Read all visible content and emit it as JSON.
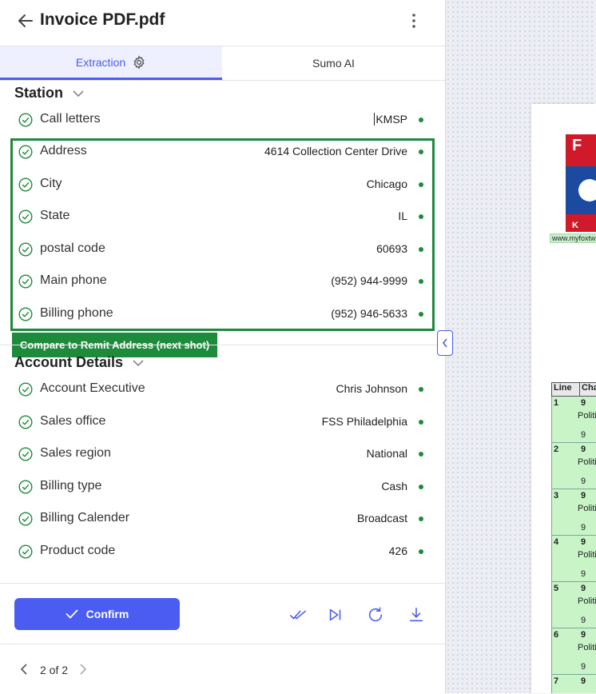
{
  "header": {
    "title": "Invoice PDF.pdf"
  },
  "tabs": [
    {
      "label": "Extraction",
      "active": true
    },
    {
      "label": "Sumo AI",
      "active": false
    }
  ],
  "station": {
    "title": "Station",
    "fields": [
      {
        "label": "Call letters",
        "value": "KMSP"
      },
      {
        "label": "Address",
        "value": "4614 Collection Center Drive"
      },
      {
        "label": "City",
        "value": "Chicago"
      },
      {
        "label": "State",
        "value": "IL"
      },
      {
        "label": "postal code",
        "value": "60693"
      },
      {
        "label": "Main phone",
        "value": "(952) 944-9999"
      },
      {
        "label": "Billing phone",
        "value": "(952) 946-5633"
      }
    ]
  },
  "annotation": {
    "label": "Compare to Remit Address (next shot)"
  },
  "account": {
    "title": "Account Details",
    "fields": [
      {
        "label": "Account Executive",
        "value": "Chris Johnson"
      },
      {
        "label": "Sales office",
        "value": "FSS Philadelphia"
      },
      {
        "label": "Sales region",
        "value": "National"
      },
      {
        "label": "Billing type",
        "value": "Cash"
      },
      {
        "label": "Billing Calender",
        "value": "Broadcast"
      },
      {
        "label": "Product code",
        "value": "426"
      }
    ]
  },
  "footer": {
    "confirm_label": "Confirm"
  },
  "pager": {
    "label": "2 of 2"
  },
  "document": {
    "logo_text": "K",
    "url_text": "www.myfoxtw",
    "table_header": [
      "Line",
      "Cha"
    ],
    "rows": [
      {
        "line": "1",
        "v1": "9",
        "v2": "Politi",
        "v3": "9"
      },
      {
        "line": "2",
        "v1": "9",
        "v2": "Politi",
        "v3": "9"
      },
      {
        "line": "3",
        "v1": "9",
        "v2": "Politi",
        "v3": "9"
      },
      {
        "line": "4",
        "v1": "9",
        "v2": "Politi",
        "v3": "9"
      },
      {
        "line": "5",
        "v1": "9",
        "v2": "Politi",
        "v3": "9"
      },
      {
        "line": "6",
        "v1": "9",
        "v2": "Politi",
        "v3": "9"
      },
      {
        "line": "7",
        "v1": "9",
        "v2": "",
        "v3": ""
      }
    ]
  },
  "colors": {
    "accent": "#4a5cf2",
    "success": "#1e8a3c"
  }
}
